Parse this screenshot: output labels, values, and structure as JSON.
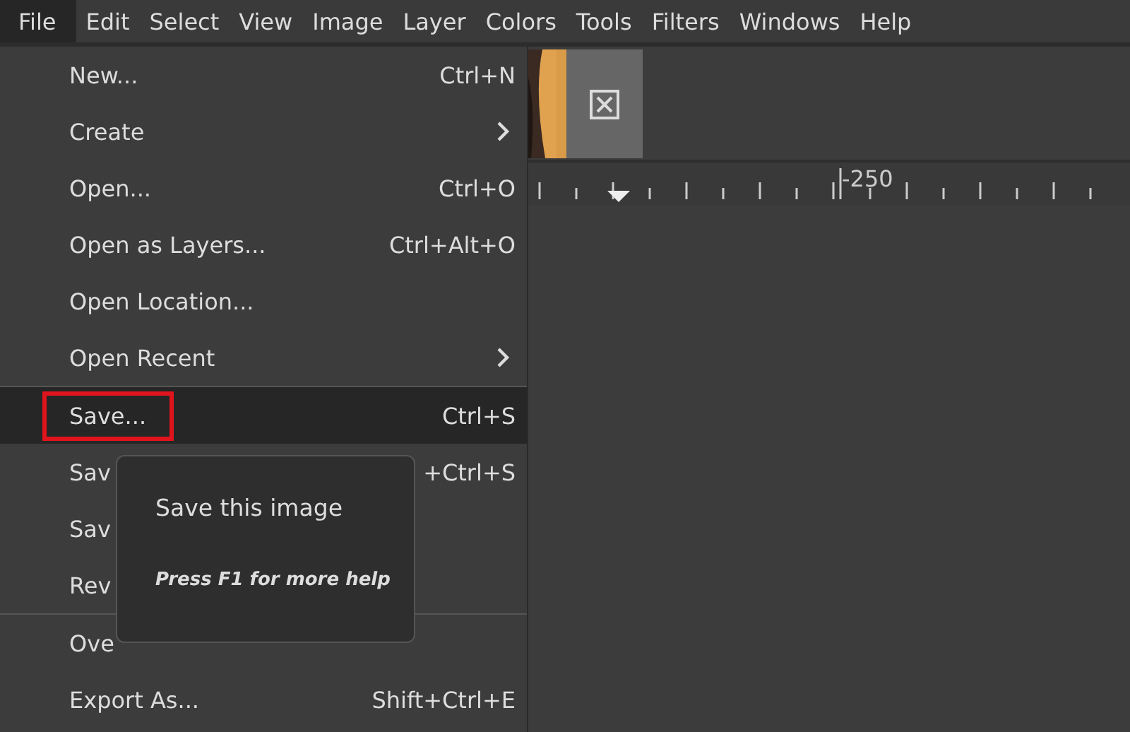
{
  "menubar": [
    {
      "label": "File",
      "selected": true
    },
    {
      "label": "Edit",
      "selected": false
    },
    {
      "label": "Select",
      "selected": false
    },
    {
      "label": "View",
      "selected": false
    },
    {
      "label": "Image",
      "selected": false
    },
    {
      "label": "Layer",
      "selected": false
    },
    {
      "label": "Colors",
      "selected": false
    },
    {
      "label": "Tools",
      "selected": false
    },
    {
      "label": "Filters",
      "selected": false
    },
    {
      "label": "Windows",
      "selected": false
    },
    {
      "label": "Help",
      "selected": false
    }
  ],
  "file_menu": [
    {
      "kind": "item",
      "label": "New...",
      "shortcut": "Ctrl+N"
    },
    {
      "kind": "item",
      "label": "Create",
      "submenu": true
    },
    {
      "kind": "item",
      "label": "Open...",
      "shortcut": "Ctrl+O"
    },
    {
      "kind": "item",
      "label": "Open as Layers...",
      "shortcut": "Ctrl+Alt+O"
    },
    {
      "kind": "item",
      "label": "Open Location..."
    },
    {
      "kind": "item",
      "label": "Open Recent",
      "submenu": true
    },
    {
      "kind": "separator"
    },
    {
      "kind": "item",
      "label": "Save...",
      "shortcut": "Ctrl+S",
      "selected": true,
      "outlined": true
    },
    {
      "kind": "item",
      "label": "Sav",
      "shortcut": "+Ctrl+S"
    },
    {
      "kind": "item",
      "label": "Sav"
    },
    {
      "kind": "item",
      "label": "Rev"
    },
    {
      "kind": "separator"
    },
    {
      "kind": "item",
      "label": "Ove"
    },
    {
      "kind": "item",
      "label": "Export As...",
      "shortcut": "Shift+Ctrl+E"
    }
  ],
  "tooltip": {
    "title": "Save this image",
    "hint": "Press F1 for more help"
  },
  "ruler": {
    "label": "-250"
  }
}
